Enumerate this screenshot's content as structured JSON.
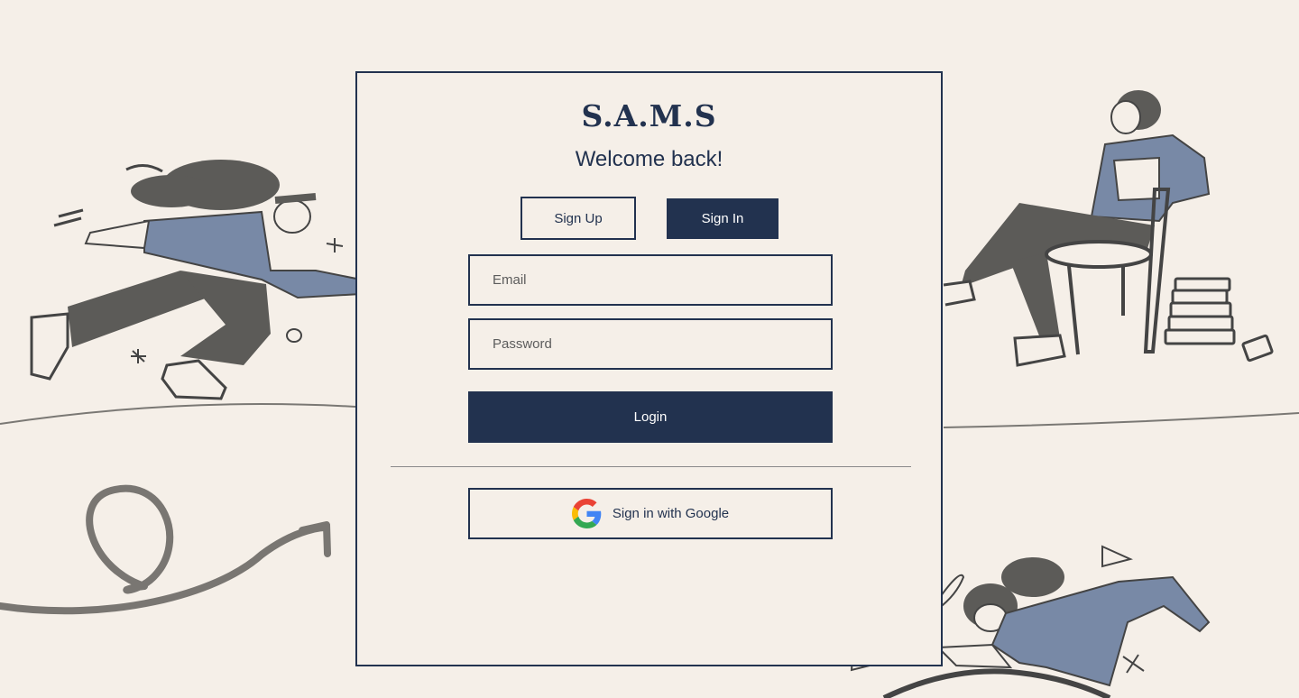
{
  "app": {
    "brand": "S.A.M.S",
    "welcome": "Welcome back!"
  },
  "auth_tabs": {
    "signup_label": "Sign Up",
    "signin_label": "Sign In",
    "active": "signin"
  },
  "form": {
    "email_placeholder": "Email",
    "email_value": "",
    "password_placeholder": "Password",
    "password_value": "",
    "login_label": "Login"
  },
  "oauth": {
    "google_label": "Sign in with Google",
    "icon": "google-icon"
  },
  "colors": {
    "background": "#f5efe8",
    "primary": "#22324f",
    "illustration_gray": "#5c5b58",
    "illustration_blue": "#7889a6"
  }
}
